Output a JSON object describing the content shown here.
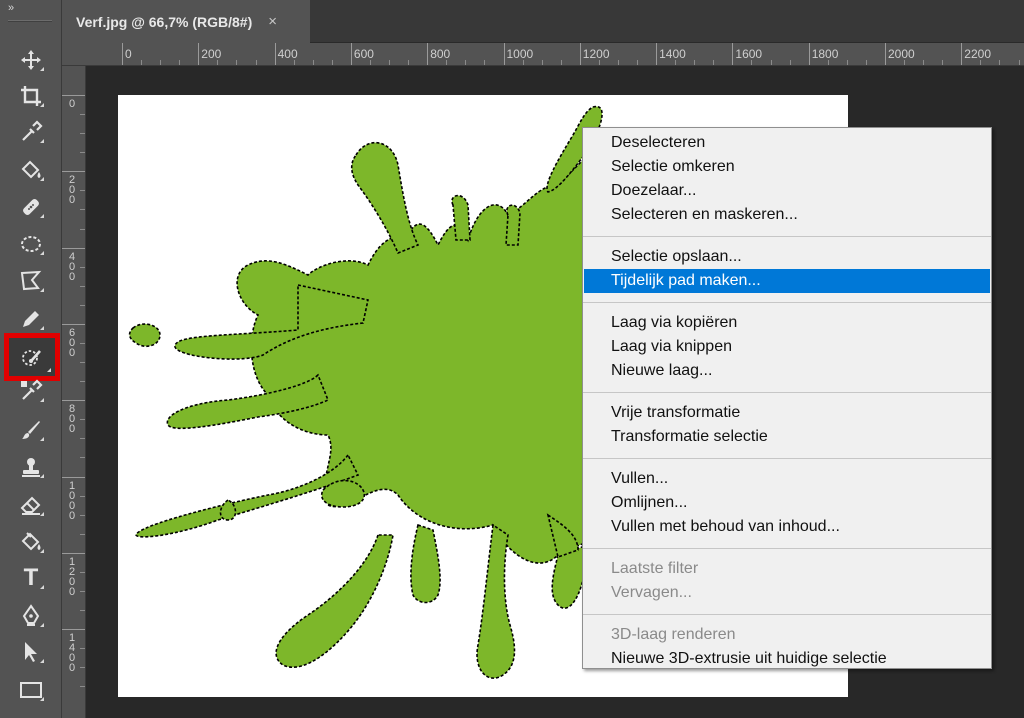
{
  "toolbar": {
    "collapse_glyph": "»",
    "type_tool_glyph": "T"
  },
  "document_tab": {
    "title": "Verf.jpg @ 66,7% (RGB/8#)",
    "close_glyph": "×"
  },
  "ruler_top": {
    "labels": [
      "0",
      "200",
      "400",
      "600",
      "800",
      "1000",
      "1200",
      "1400",
      "1600",
      "1800",
      "2000",
      "2200"
    ]
  },
  "ruler_left": {
    "labels": [
      "0",
      "200",
      "400",
      "600",
      "800",
      "1000",
      "1200",
      "1400"
    ]
  },
  "canvas": {
    "background_color": "#ffffff",
    "splat_color": "#7db72a"
  },
  "context_menu": {
    "groups": [
      {
        "items": [
          {
            "label": "Deselecteren"
          },
          {
            "label": "Selectie omkeren"
          },
          {
            "label": "Doezelaar..."
          },
          {
            "label": "Selecteren en maskeren..."
          }
        ]
      },
      {
        "items": [
          {
            "label": "Selectie opslaan..."
          },
          {
            "label": "Tijdelijk pad maken..."
          }
        ]
      },
      {
        "items": [
          {
            "label": "Laag via kopiëren"
          },
          {
            "label": "Laag via knippen"
          },
          {
            "label": "Nieuwe laag..."
          }
        ]
      },
      {
        "items": [
          {
            "label": "Vrije transformatie"
          },
          {
            "label": "Transformatie selectie"
          }
        ]
      },
      {
        "items": [
          {
            "label": "Vullen..."
          },
          {
            "label": "Omlijnen..."
          },
          {
            "label": "Vullen met behoud van inhoud..."
          }
        ]
      },
      {
        "items": [
          {
            "label": "Laatste filter"
          },
          {
            "label": "Vervagen..."
          }
        ]
      },
      {
        "items": [
          {
            "label": "3D-laag renderen"
          },
          {
            "label": "Nieuwe 3D-extrusie uit huidige selectie"
          }
        ]
      }
    ],
    "highlighted_item": "Tijdelijk pad maken...",
    "disabled_items": [
      "Laatste filter",
      "Vervagen...",
      "3D-laag renderen"
    ],
    "highlight_color": "#0078d7"
  },
  "tools": [
    "move-tool",
    "crop-tool",
    "eyedropper-tool",
    "paint-bucket-tool",
    "healing-brush-tool",
    "elliptical-marquee-tool",
    "polygonal-lasso-tool",
    "pen-brush-tool",
    "quick-selection-tool",
    "color-sampler-tool",
    "brush-tool",
    "clone-stamp-tool",
    "eraser-tool",
    "gradient-fill-tool",
    "type-tool",
    "pen-tool",
    "path-selection-tool",
    "rectangle-tool"
  ],
  "highlight_tool": "quick-selection-tool",
  "highlight_outline_color": "#e10000"
}
